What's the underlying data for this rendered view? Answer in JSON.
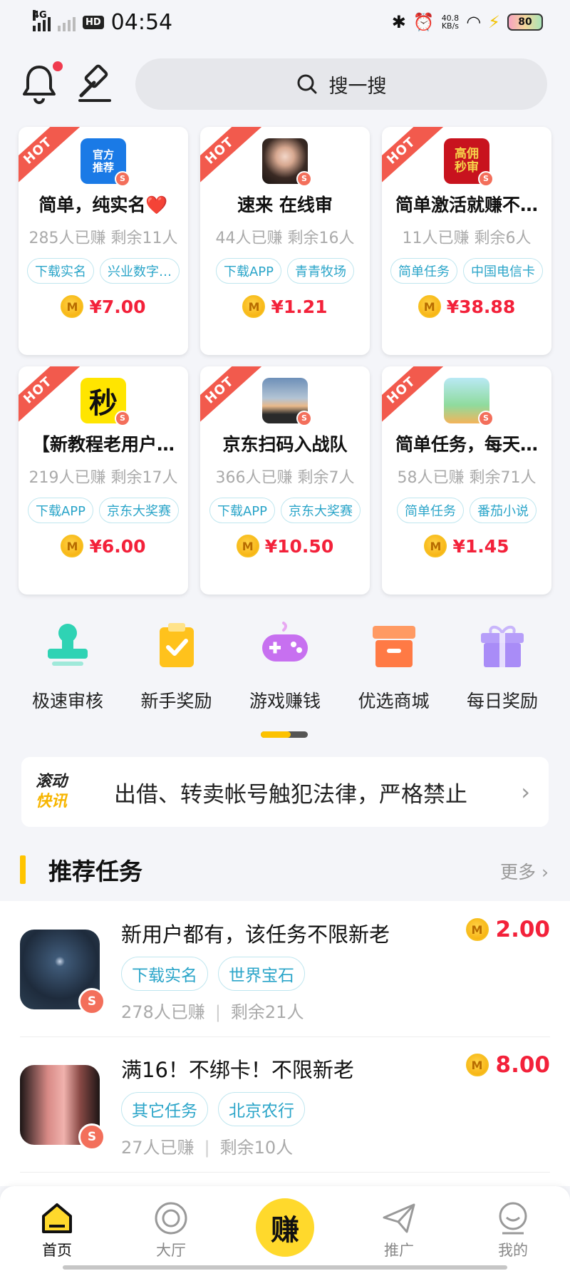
{
  "status": {
    "network": "4G",
    "hd": "HD",
    "time": "04:54",
    "speed_value": "40.8",
    "speed_unit": "KB/s",
    "battery": "80"
  },
  "search": {
    "placeholder": "搜一搜"
  },
  "hot_label": "HOT",
  "cards": [
    {
      "thumb_text": "官方\n推荐",
      "title": "简单，纯实名❤️",
      "stats": "285人已赚  剩余11人",
      "tags": [
        "下载实名",
        "兴业数字…"
      ],
      "price": "¥7.00"
    },
    {
      "thumb_text": "",
      "title": "速来  在线审",
      "stats": "44人已赚  剩余16人",
      "tags": [
        "下载APP",
        "青青牧场"
      ],
      "price": "¥1.21"
    },
    {
      "thumb_text": "高佣\n秒审",
      "title": "简单激活就赚不…",
      "stats": "11人已赚  剩余6人",
      "tags": [
        "简单任务",
        "中国电信卡"
      ],
      "price": "¥38.88"
    },
    {
      "thumb_text": "秒",
      "title": "【新教程老用户…",
      "stats": "219人已赚  剩余17人",
      "tags": [
        "下载APP",
        "京东大奖赛"
      ],
      "price": "¥6.00"
    },
    {
      "thumb_text": "",
      "title": "京东扫码入战队",
      "stats": "366人已赚  剩余7人",
      "tags": [
        "下载APP",
        "京东大奖赛"
      ],
      "price": "¥10.50"
    },
    {
      "thumb_text": "",
      "title": "简单任务，每天…",
      "stats": "58人已赚  剩余71人",
      "tags": [
        "简单任务",
        "番茄小说"
      ],
      "price": "¥1.45"
    }
  ],
  "shortcuts": [
    {
      "label": "极速审核",
      "icon": "stamp-icon",
      "color": "#2fd3b4"
    },
    {
      "label": "新手奖励",
      "icon": "clipboard-check-icon",
      "color": "#ffc21c"
    },
    {
      "label": "游戏赚钱",
      "icon": "gamepad-icon",
      "color": "#c770f0"
    },
    {
      "label": "优选商城",
      "icon": "box-icon",
      "color": "#ff7a45"
    },
    {
      "label": "每日奖励",
      "icon": "gift-icon",
      "color": "#a98cf7"
    }
  ],
  "news": {
    "logo_a": "滚动",
    "logo_b": "快讯",
    "text": "出借、转卖帐号触犯法律，严格禁止"
  },
  "section": {
    "title": "推荐任务",
    "more": "更多"
  },
  "coin_letter": "M",
  "shield_letter": "S",
  "tasks": [
    {
      "title": "新用户都有，该任务不限新老",
      "tags": [
        "下载实名",
        "世界宝石"
      ],
      "earned": "278人已赚",
      "remaining": "剩余21人",
      "price": "2.00"
    },
    {
      "title": "满16！不绑卡！不限新老",
      "tags": [
        "其它任务",
        "北京农行"
      ],
      "earned": "27人已赚",
      "remaining": "剩余10人",
      "price": "8.00"
    }
  ],
  "tabbar": {
    "home": "首页",
    "hall": "大厅",
    "earn": "赚",
    "promote": "推广",
    "mine": "我的"
  },
  "colors": {
    "accent": "#ffc400",
    "price": "#f3213a",
    "tag": "#2ba5c9",
    "hot": "#f25a4d"
  }
}
